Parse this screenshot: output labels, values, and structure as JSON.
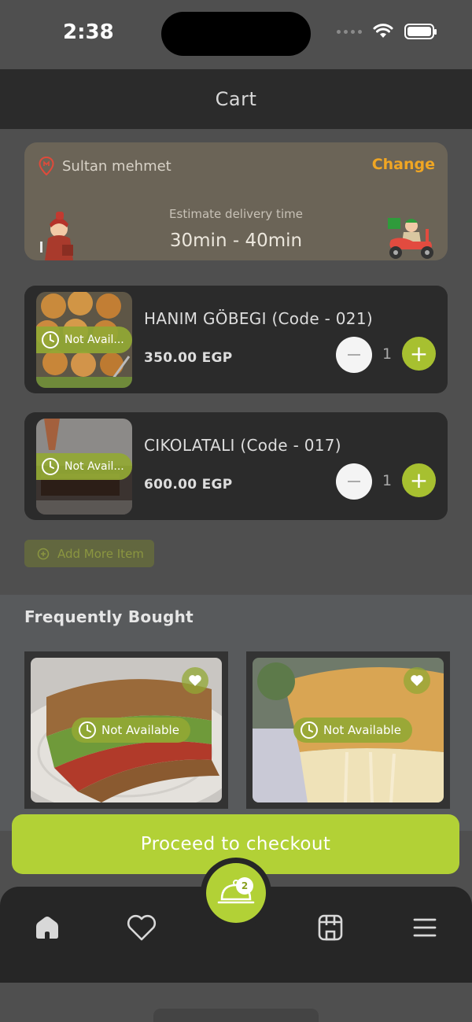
{
  "status_bar": {
    "time": "2:38"
  },
  "header": {
    "title": "Cart"
  },
  "delivery": {
    "address": "Sultan mehmet",
    "change_label": "Change",
    "estimate_label": "Estimate delivery time",
    "estimate_value": "30min - 40min"
  },
  "cart_items": [
    {
      "name": "HANIM GÖBEGI (Code - 021)",
      "price": "350.00 EGP",
      "quantity": "1",
      "availability": "Not Avail..."
    },
    {
      "name": "CIKOLATALI (Code - 017)",
      "price": "600.00 EGP",
      "quantity": "1",
      "availability": "Not Avail..."
    }
  ],
  "add_more_label": "Add More Item",
  "frequently_bought": {
    "title": "Frequently Bought",
    "items": [
      {
        "availability": "Not Available"
      },
      {
        "availability": "Not Available"
      }
    ]
  },
  "checkout_label": "Proceed to checkout",
  "tab_bar": {
    "cart_badge": "2"
  },
  "colors": {
    "accent": "#b2d136",
    "change_link": "#f0a623",
    "panel": "#2b2b2b"
  }
}
